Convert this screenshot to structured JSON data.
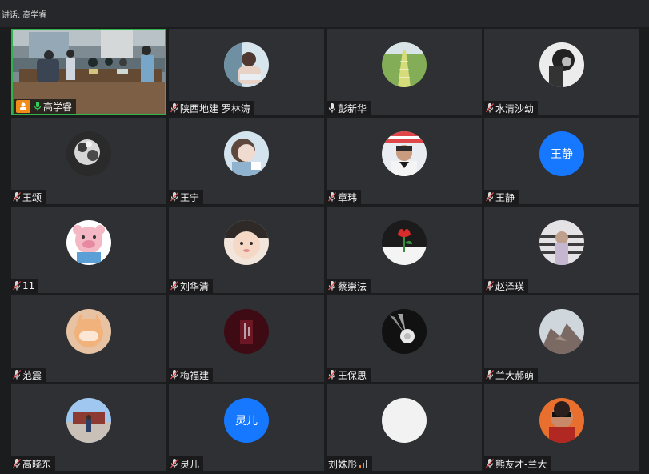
{
  "topbar": {
    "speaking_text": "讲话: 高学睿"
  },
  "colors": {
    "tile_bg": "#2e3033",
    "active_border": "#2fb34a",
    "initials_avatar_bg": "#1677ff",
    "user_badge": "#f08c1a"
  },
  "participants": [
    {
      "name": "高学睿",
      "video": true,
      "mic": "green-mic-icon",
      "badge": "user-icon"
    },
    {
      "name": "陕西地建  罗林涛",
      "mic": "muted-mic-icon",
      "avatar": "photo"
    },
    {
      "name": "彭新华",
      "mic": "mic-icon",
      "avatar": "photo"
    },
    {
      "name": "水清沙幼",
      "mic": "muted-mic-icon",
      "avatar": "photo"
    },
    {
      "name": "王颂",
      "mic": "muted-mic-icon",
      "avatar": "photo"
    },
    {
      "name": "王宁",
      "mic": "muted-mic-icon",
      "avatar": "photo"
    },
    {
      "name": "章玮",
      "mic": "muted-mic-icon",
      "avatar": "photo"
    },
    {
      "name": "王静",
      "mic": "muted-mic-icon",
      "avatar_text": "王静"
    },
    {
      "name": "11",
      "mic": "muted-mic-icon",
      "avatar": "photo"
    },
    {
      "name": "刘华清",
      "mic": "muted-mic-icon",
      "avatar": "photo"
    },
    {
      "name": "蔡崇法",
      "mic": "muted-mic-icon",
      "avatar": "photo"
    },
    {
      "name": "赵泽瑛",
      "mic": "muted-mic-icon",
      "avatar": "photo"
    },
    {
      "name": "范震",
      "mic": "muted-mic-icon",
      "avatar": "photo"
    },
    {
      "name": "梅福建",
      "mic": "muted-mic-icon",
      "avatar": "photo"
    },
    {
      "name": "王保思",
      "mic": "muted-mic-icon",
      "avatar": "photo"
    },
    {
      "name": "兰大郝萌",
      "mic": "muted-mic-icon",
      "avatar": "photo"
    },
    {
      "name": "高晓东",
      "mic": "muted-mic-icon",
      "avatar": "photo"
    },
    {
      "name": "灵儿",
      "mic": "muted-mic-icon",
      "avatar_text": "灵儿"
    },
    {
      "name": "刘姝彤",
      "mic": "signal-icon",
      "avatar": "blank"
    },
    {
      "name": "熊友才-兰大",
      "mic": "muted-mic-icon",
      "avatar": "photo"
    }
  ]
}
